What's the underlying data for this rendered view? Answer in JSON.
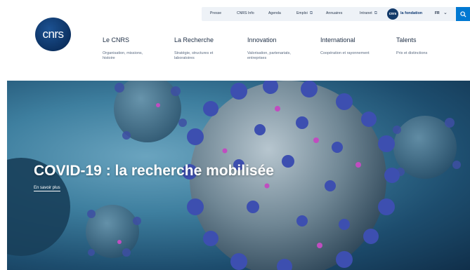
{
  "utility": {
    "links": [
      "Presse",
      "CNRS Info",
      "Agenda",
      "Emploi",
      "Annuaires",
      "Intranet"
    ],
    "fondation_logo": "cnrs",
    "fondation_label": "la fondation",
    "language": "FR",
    "icons": {
      "external": "external-link-icon",
      "search": "search-icon",
      "chevron": "chevron-down-icon"
    },
    "search_color": "#0078d2"
  },
  "logo": {
    "text": "cnrs",
    "color": "#0b2f5e"
  },
  "nav": [
    {
      "title": "Le CNRS",
      "desc": "Organisation, missions, histoire"
    },
    {
      "title": "La Recherche",
      "desc": "Stratégie, structures et laboratoires"
    },
    {
      "title": "Innovation",
      "desc": "Valorisation, partenariats, entreprises"
    },
    {
      "title": "International",
      "desc": "Coopération et rayonnement"
    },
    {
      "title": "Talents",
      "desc": "Prix et distinctions"
    }
  ],
  "hero": {
    "title": "COVID-19 : la recherche mobilisée",
    "link": "En savoir plus"
  }
}
